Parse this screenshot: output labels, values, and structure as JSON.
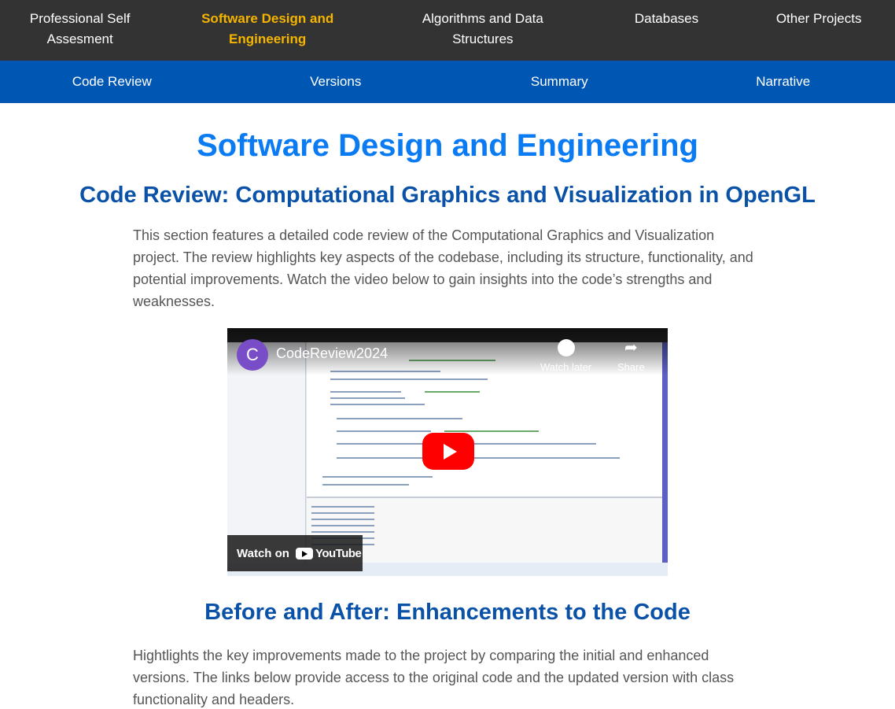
{
  "top_nav": [
    {
      "label": "Professional Self Assesment"
    },
    {
      "label": "Software Design and Engineering"
    },
    {
      "label": "Algorithms and Data Structures"
    },
    {
      "label": "Databases"
    },
    {
      "label": "Other Projects"
    }
  ],
  "sub_nav": [
    {
      "label": "Code Review"
    },
    {
      "label": "Versions"
    },
    {
      "label": "Summary"
    },
    {
      "label": "Narrative"
    }
  ],
  "page_title": "Software Design and Engineering",
  "code_review": {
    "heading": "Code Review: Computational Graphics and Visualization in OpenGL",
    "paragraph": "This section features a detailed code review of the Computational Graphics and Visualization project. The review highlights key aspects of the codebase, including its structure, functionality, and potential improvements. Watch the video below to gain insights into the code’s strengths and weaknesses."
  },
  "video": {
    "channel_initial": "C",
    "title": "CodeReview2024",
    "watch_later": "Watch later",
    "share": "Share",
    "watch_on": "Watch on",
    "youtube": "YouTube",
    "accent": "#ff0000"
  },
  "before_after": {
    "heading": "Before and After: Enhancements to the Code",
    "paragraph": "Hightlights the key improvements made to the project by comparing the initial and enhanced versions. The links below provide access to the original code and the updated version with class functionality and headers."
  }
}
